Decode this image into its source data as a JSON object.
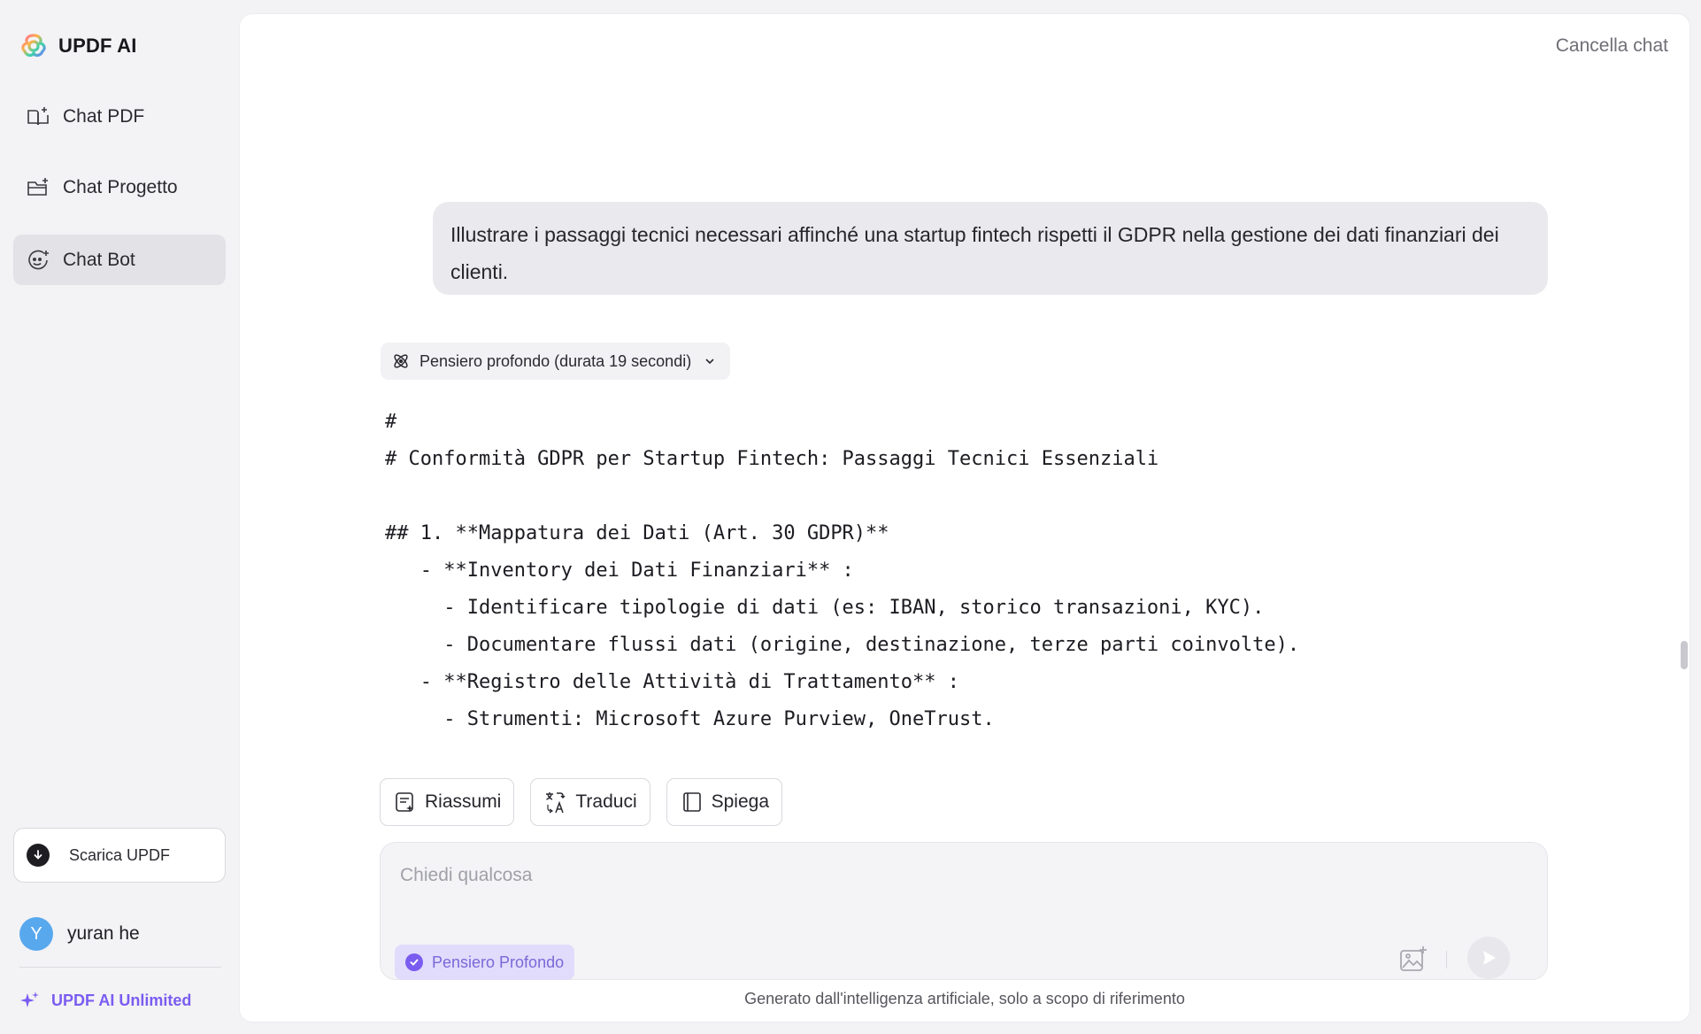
{
  "brand": {
    "name": "UPDF AI",
    "logo_icon": "updf-flower-logo"
  },
  "sidebar": {
    "items": [
      {
        "label": "Chat PDF",
        "icon": "book-icon",
        "active": false
      },
      {
        "label": "Chat Progetto",
        "icon": "folder-icon",
        "active": false
      },
      {
        "label": "Chat Bot",
        "icon": "bot-face-icon",
        "active": true
      }
    ],
    "download_label": "Scarica UPDF",
    "user": {
      "avatar_letter": "Y",
      "name": "yuran he"
    },
    "unlimited_label": "UPDF AI Unlimited"
  },
  "header": {
    "clear_chat_label": "Cancella chat"
  },
  "conversation": {
    "user_message": "Illustrare i passaggi tecnici necessari affinché una startup fintech rispetti il GDPR nella gestione dei dati finanziari dei clienti.",
    "thinking_label": "Pensiero profondo (durata 19 secondi)",
    "answer_lines": [
      "#",
      "# Conformità GDPR per Startup Fintech: Passaggi Tecnici Essenziali",
      "",
      "## 1. **Mappatura dei Dati (Art. 30 GDPR)**",
      "   - **Inventory dei Dati Finanziari** :",
      "     - Identificare tipologie di dati (es: IBAN, storico transazioni, KYC).",
      "     - Documentare flussi dati (origine, destinazione, terze parti coinvolte).",
      "   - **Registro delle Attività di Trattamento** :",
      "     - Strumenti: Microsoft Azure Purview, OneTrust."
    ]
  },
  "actions": {
    "summarize": "Riassumi",
    "translate": "Traduci",
    "explain": "Spiega"
  },
  "composer": {
    "placeholder": "Chiedi qualcosa",
    "value": "",
    "deep_thinking_label": "Pensiero Profondo"
  },
  "footer": {
    "disclaimer": "Generato dall'intelligenza artificiale, solo a scopo di riferimento"
  },
  "colors": {
    "accent": "#7b5cf0",
    "active_nav": "#e2e2e7",
    "bubble": "#e9e9ee"
  }
}
